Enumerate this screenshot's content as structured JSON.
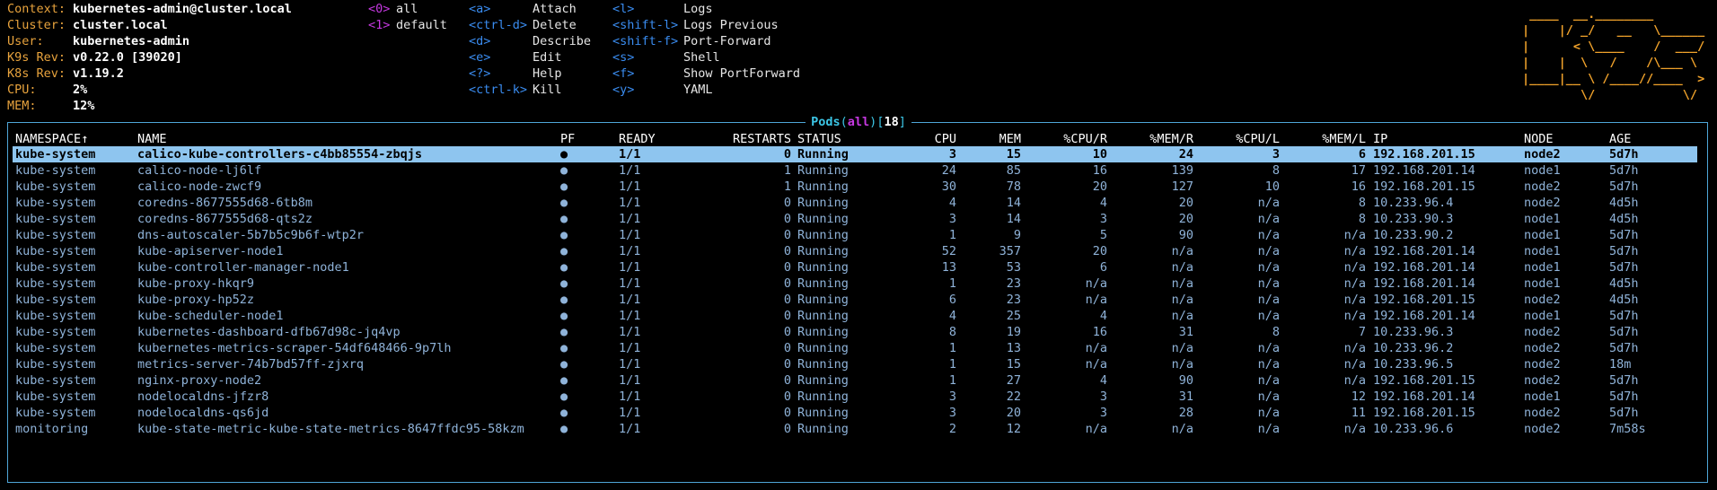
{
  "context": {
    "labels": [
      "Context:",
      "Cluster:",
      "User:",
      "K9s Rev:",
      "K8s Rev:",
      "CPU:",
      "MEM:"
    ],
    "values": [
      "kubernetes-admin@cluster.local",
      "cluster.local",
      "kubernetes-admin",
      "v0.22.0 [39020]",
      "v1.19.2",
      "2%",
      "12%"
    ]
  },
  "namespaces": [
    {
      "key": "<0>",
      "label": "all"
    },
    {
      "key": "<1>",
      "label": "default"
    }
  ],
  "hotkeys": [
    [
      {
        "key": "<a>",
        "label": "Attach"
      },
      {
        "key": "<ctrl-d>",
        "label": "Delete"
      },
      {
        "key": "<d>",
        "label": "Describe"
      },
      {
        "key": "<e>",
        "label": "Edit"
      },
      {
        "key": "<?>",
        "label": "Help"
      },
      {
        "key": "<ctrl-k>",
        "label": "Kill"
      }
    ],
    [
      {
        "key": "<l>",
        "label": "Logs"
      },
      {
        "key": "<shift-l>",
        "label": "Logs Previous"
      },
      {
        "key": "<shift-f>",
        "label": "Port-Forward"
      },
      {
        "key": "<s>",
        "label": "Shell"
      },
      {
        "key": "<f>",
        "label": "Show PortForward"
      },
      {
        "key": "<y>",
        "label": "YAML"
      }
    ]
  ],
  "logo": [
    " ____  __.________       ",
    "|    |/ _/   __   \\______",
    "|      < \\____    /  ___/",
    "|    |  \\   /    /\\___ \\ ",
    "|____|__ \\ /____//____  >",
    "        \\/            \\/ "
  ],
  "title": {
    "resource": "Pods",
    "open": "(",
    "namespace": "all",
    "close": ")",
    "count_open": "[",
    "count": "18",
    "count_close": "]"
  },
  "table": {
    "headers": [
      "NAMESPACE",
      "NAME",
      "PF",
      "READY",
      "RESTARTS",
      "STATUS",
      "CPU",
      "MEM",
      "%CPU/R",
      "%MEM/R",
      "%CPU/L",
      "%MEM/L",
      "IP",
      "NODE",
      "AGE"
    ],
    "sort_arrow": "↑",
    "selected_index": 0,
    "rows": [
      [
        "kube-system",
        "calico-kube-controllers-c4bb85554-zbqjs",
        "●",
        "1/1",
        "0",
        "Running",
        "3",
        "15",
        "10",
        "24",
        "3",
        "6",
        "192.168.201.15",
        "node2",
        "5d7h"
      ],
      [
        "kube-system",
        "calico-node-lj6lf",
        "●",
        "1/1",
        "1",
        "Running",
        "24",
        "85",
        "16",
        "139",
        "8",
        "17",
        "192.168.201.14",
        "node1",
        "5d7h"
      ],
      [
        "kube-system",
        "calico-node-zwcf9",
        "●",
        "1/1",
        "1",
        "Running",
        "30",
        "78",
        "20",
        "127",
        "10",
        "16",
        "192.168.201.15",
        "node2",
        "5d7h"
      ],
      [
        "kube-system",
        "coredns-8677555d68-6tb8m",
        "●",
        "1/1",
        "0",
        "Running",
        "4",
        "14",
        "4",
        "20",
        "n/a",
        "8",
        "10.233.96.4",
        "node2",
        "4d5h"
      ],
      [
        "kube-system",
        "coredns-8677555d68-qts2z",
        "●",
        "1/1",
        "0",
        "Running",
        "3",
        "14",
        "3",
        "20",
        "n/a",
        "8",
        "10.233.90.3",
        "node1",
        "4d5h"
      ],
      [
        "kube-system",
        "dns-autoscaler-5b7b5c9b6f-wtp2r",
        "●",
        "1/1",
        "0",
        "Running",
        "1",
        "9",
        "5",
        "90",
        "n/a",
        "n/a",
        "10.233.90.2",
        "node1",
        "5d7h"
      ],
      [
        "kube-system",
        "kube-apiserver-node1",
        "●",
        "1/1",
        "0",
        "Running",
        "52",
        "357",
        "20",
        "n/a",
        "n/a",
        "n/a",
        "192.168.201.14",
        "node1",
        "5d7h"
      ],
      [
        "kube-system",
        "kube-controller-manager-node1",
        "●",
        "1/1",
        "0",
        "Running",
        "13",
        "53",
        "6",
        "n/a",
        "n/a",
        "n/a",
        "192.168.201.14",
        "node1",
        "5d7h"
      ],
      [
        "kube-system",
        "kube-proxy-hkqr9",
        "●",
        "1/1",
        "0",
        "Running",
        "1",
        "23",
        "n/a",
        "n/a",
        "n/a",
        "n/a",
        "192.168.201.14",
        "node1",
        "4d5h"
      ],
      [
        "kube-system",
        "kube-proxy-hp52z",
        "●",
        "1/1",
        "0",
        "Running",
        "6",
        "23",
        "n/a",
        "n/a",
        "n/a",
        "n/a",
        "192.168.201.15",
        "node2",
        "4d5h"
      ],
      [
        "kube-system",
        "kube-scheduler-node1",
        "●",
        "1/1",
        "0",
        "Running",
        "4",
        "25",
        "4",
        "n/a",
        "n/a",
        "n/a",
        "192.168.201.14",
        "node1",
        "5d7h"
      ],
      [
        "kube-system",
        "kubernetes-dashboard-dfb67d98c-jq4vp",
        "●",
        "1/1",
        "0",
        "Running",
        "8",
        "19",
        "16",
        "31",
        "8",
        "7",
        "10.233.96.3",
        "node2",
        "5d7h"
      ],
      [
        "kube-system",
        "kubernetes-metrics-scraper-54df648466-9p7lh",
        "●",
        "1/1",
        "0",
        "Running",
        "1",
        "13",
        "n/a",
        "n/a",
        "n/a",
        "n/a",
        "10.233.96.2",
        "node2",
        "5d7h"
      ],
      [
        "kube-system",
        "metrics-server-74b7bd57ff-zjxrq",
        "●",
        "1/1",
        "0",
        "Running",
        "1",
        "15",
        "n/a",
        "n/a",
        "n/a",
        "n/a",
        "10.233.96.5",
        "node2",
        "18m"
      ],
      [
        "kube-system",
        "nginx-proxy-node2",
        "●",
        "1/1",
        "0",
        "Running",
        "1",
        "27",
        "4",
        "90",
        "n/a",
        "n/a",
        "192.168.201.15",
        "node2",
        "5d7h"
      ],
      [
        "kube-system",
        "nodelocaldns-jfzr8",
        "●",
        "1/1",
        "0",
        "Running",
        "3",
        "22",
        "3",
        "31",
        "n/a",
        "12",
        "192.168.201.14",
        "node1",
        "5d7h"
      ],
      [
        "kube-system",
        "nodelocaldns-qs6jd",
        "●",
        "1/1",
        "0",
        "Running",
        "3",
        "20",
        "3",
        "28",
        "n/a",
        "11",
        "192.168.201.15",
        "node2",
        "5d7h"
      ],
      [
        "monitoring",
        "kube-state-metric-kube-state-metrics-8647ffdc95-58kzm",
        "●",
        "1/1",
        "0",
        "Running",
        "2",
        "12",
        "n/a",
        "n/a",
        "n/a",
        "n/a",
        "10.233.96.6",
        "node2",
        "7m58s"
      ]
    ]
  },
  "colors": {
    "label": "#e8a33d",
    "hotkey": "#3a8cf0",
    "namespace_key": "#c538e0",
    "border": "#4fa6d8",
    "selected_row": "#8ec5ef",
    "row_text": "#8fb3d9",
    "logo": "#f2a32b"
  }
}
